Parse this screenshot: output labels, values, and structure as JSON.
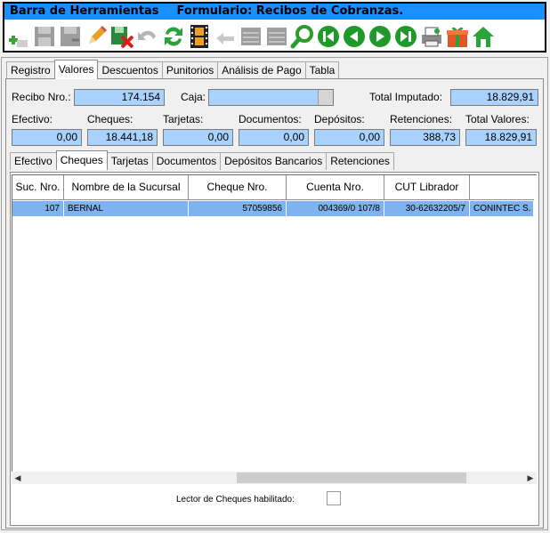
{
  "toolbar": {
    "title": "Barra de Herramientas",
    "form_title": "Formulario: Recibos de Cobranzas."
  },
  "top_tabs": [
    "Registro",
    "Valores",
    "Descuentos",
    "Punitorios",
    "Análisis de Pago",
    "Tabla"
  ],
  "header": {
    "recibo_label": "Recibo Nro.:",
    "recibo_value": "174.154",
    "caja_label": "Caja:",
    "caja_value": "",
    "total_imputado_label": "Total Imputado:",
    "total_imputado_value": "18.829,91"
  },
  "totals": {
    "efectivo_label": "Efectivo:",
    "efectivo_value": "0,00",
    "cheques_label": "Cheques:",
    "cheques_value": "18.441,18",
    "tarjetas_label": "Tarjetas:",
    "tarjetas_value": "0,00",
    "documentos_label": "Documentos:",
    "documentos_value": "0,00",
    "depositos_label": "Depósitos:",
    "depositos_value": "0,00",
    "retenciones_label": "Retenciones:",
    "retenciones_value": "388,73",
    "total_valores_label": "Total Valores:",
    "total_valores_value": "18.829,91"
  },
  "inner_tabs": [
    "Efectivo",
    "Cheques",
    "Tarjetas",
    "Documentos",
    "Depósitos Bancarios",
    "Retenciones"
  ],
  "grid": {
    "columns": [
      "Suc. Nro.",
      "Nombre de la Sucursal",
      "Cheque Nro.",
      "Cuenta Nro.",
      "CUT Librador",
      ""
    ],
    "rows": [
      [
        "107",
        "BERNAL",
        "57059856",
        "004369/0 107/8",
        "30-62632205/7",
        "CONINTEC S."
      ]
    ]
  },
  "lector_label": "Lector de Cheques habilitado:",
  "colors": {
    "title_bar": "#1c8fff",
    "field_bg": "#a9d2ff",
    "selected_row": "#7fb3f0"
  }
}
